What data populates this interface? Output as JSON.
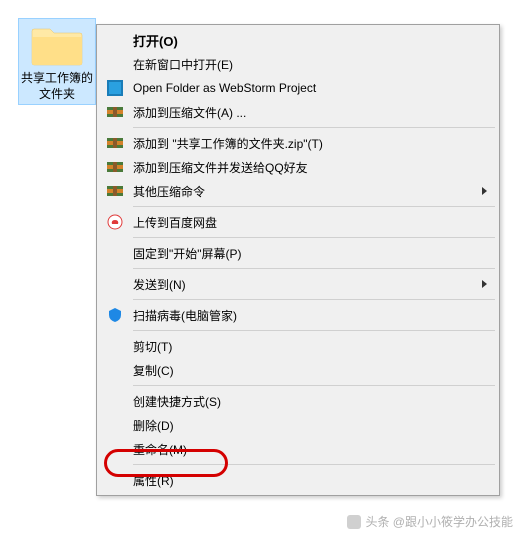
{
  "folder": {
    "name": "共享工作簿的文件夹"
  },
  "menu": {
    "open": "打开(O)",
    "open_new_window": "在新窗口中打开(E)",
    "open_webstorm": "Open Folder as WebStorm Project",
    "add_compress": "添加到压缩文件(A) ...",
    "add_to_zip": "添加到 \"共享工作簿的文件夹.zip\"(T)",
    "compress_send_qq": "添加到压缩文件并发送给QQ好友",
    "other_compress": "其他压缩命令",
    "upload_baidu": "上传到百度网盘",
    "pin_start": "固定到\"开始\"屏幕(P)",
    "send_to": "发送到(N)",
    "scan_virus": "扫描病毒(电脑管家)",
    "cut": "剪切(T)",
    "copy": "复制(C)",
    "create_shortcut": "创建快捷方式(S)",
    "delete": "删除(D)",
    "rename": "重命名(M)",
    "properties": "属性(R)"
  },
  "watermark": "头条 @跟小小筱学办公技能"
}
